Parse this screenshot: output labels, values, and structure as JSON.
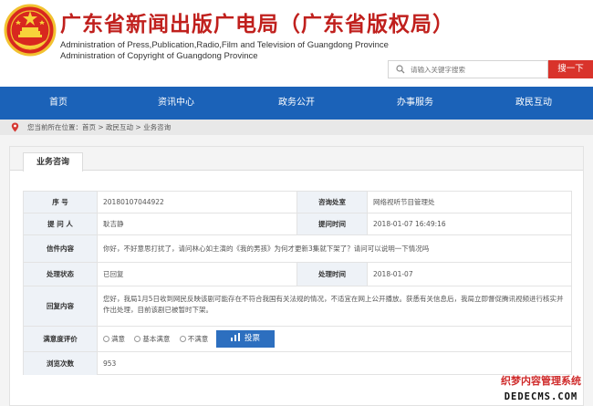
{
  "header": {
    "title_cn": "广东省新闻出版广电局（广东省版权局）",
    "title_en_1": "Administration of Press,Publication,Radio,Film and Television of Guangdong Province",
    "title_en_2": "Administration of Copyright of Guangdong Province",
    "search_placeholder": "请输入关键字搜索",
    "search_button": "搜一下"
  },
  "nav": {
    "items": [
      {
        "label": "首页"
      },
      {
        "label": "资讯中心"
      },
      {
        "label": "政务公开"
      },
      {
        "label": "办事服务"
      },
      {
        "label": "政民互动"
      }
    ]
  },
  "breadcrumb": {
    "text": "您当前所在位置：首页 > 政民互动 > 业务咨询"
  },
  "panel": {
    "tab": "业务咨询",
    "fields": {
      "serial_label": "序      号",
      "serial_value": "20180107044922",
      "dept_label": "咨询处室",
      "dept_value": "网络视听节目管理处",
      "asker_label": "提 问 人",
      "asker_value": "耿吉静",
      "ask_time_label": "提问时间",
      "ask_time_value": "2018-01-07 16:49:16",
      "content_label": "信件内容",
      "content_value": "你好，不好意思打扰了，请问林心如主演的《我的男孩》为何才更新3集就下架了？请问可以说明一下情况吗",
      "status_label": "处理状态",
      "status_value": "已回复",
      "handle_time_label": "处理时间",
      "handle_time_value": "2018-01-07",
      "reply_label": "回复内容",
      "reply_value": "您好，我局1月5日收到网民反映该剧可能存在不符合我国有关法规的情况，不适宜在网上公开播放。获悉有关信息后，我局立即督促腾讯视频进行核实并作出处理，目前该剧已被暂时下架。",
      "rating_label": "满意度评价",
      "rating_options": [
        "满意",
        "基本满意",
        "不满意"
      ],
      "vote_button": "投票",
      "views_label": "浏览次数",
      "views_value": "953"
    }
  },
  "watermark": {
    "line1": "织梦内容管理系统",
    "line2": "DEDECMS.COM"
  },
  "colors": {
    "brand_red": "#c0201d",
    "nav_blue": "#1b62b8",
    "button_blue": "#2d6fbf",
    "search_red": "#d9332b"
  }
}
